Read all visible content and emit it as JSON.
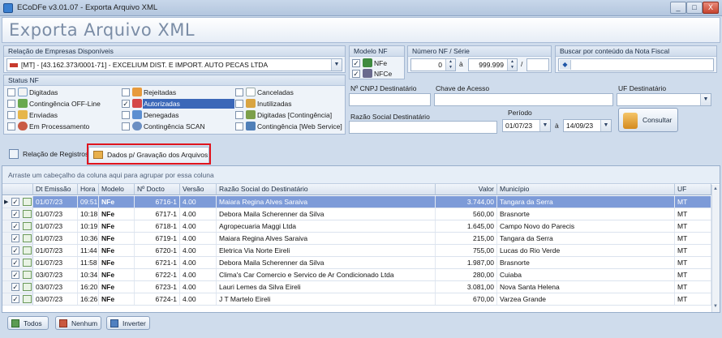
{
  "window": {
    "title": "ECoDFe v3.01.07 - Exporta Arquivo XML",
    "minimize": "_",
    "maximize": "□",
    "close": "X"
  },
  "header": {
    "title": "Exporta Arquivo XML"
  },
  "empresas": {
    "label": "Relação de Empresas Disponíveis",
    "selected": "[MT] - [43.162.373/0001-71] - EXCELIUM DIST. E IMPORT. AUTO PECAS LTDA"
  },
  "modelo": {
    "label": "Modelo NF",
    "nfe": "NFe",
    "nfce": "NFCe"
  },
  "numero": {
    "label": "Número NF / Série",
    "from": "0",
    "sep": "à",
    "to": "999.999",
    "slash": "/"
  },
  "buscar": {
    "label": "Buscar por conteúdo da Nota Fiscal"
  },
  "status": {
    "label": "Status NF",
    "items": [
      {
        "label": "Digitadas",
        "checked": false
      },
      {
        "label": "Contingência OFF-Line",
        "checked": false
      },
      {
        "label": "Enviadas",
        "checked": false
      },
      {
        "label": "Em Processamento",
        "checked": false
      },
      {
        "label": "Rejeitadas",
        "checked": false
      },
      {
        "label": "Autorizadas",
        "checked": true
      },
      {
        "label": "Denegadas",
        "checked": false
      },
      {
        "label": "Contingência SCAN",
        "checked": false
      },
      {
        "label": "Canceladas",
        "checked": false
      },
      {
        "label": "Inutilizadas",
        "checked": false
      },
      {
        "label": "Digitadas [Contingência]",
        "checked": false
      },
      {
        "label": "Contingência [Web Service]",
        "checked": false
      }
    ]
  },
  "filters": {
    "cnpj_label": "Nº CNPJ Destinatário",
    "chave_label": "Chave de Acesso",
    "uf_label": "UF Destinatário",
    "razao_label": "Razão Social Destinatário",
    "periodo_label": "Período",
    "periodo_from": "01/07/23",
    "periodo_sep": "à",
    "periodo_to": "14/09/23",
    "consultar": "Consultar"
  },
  "tabs": [
    {
      "label": "Relação de Registros"
    },
    {
      "label": "Dados p/ Gravação dos Arquivos"
    }
  ],
  "grid": {
    "group_hint": "Arraste um cabeçalho da coluna aqui para agrupar por essa coluna",
    "columns": [
      "Dt Emissão",
      "Hora",
      "Modelo",
      "Nº Docto",
      "Versão",
      "Razão Social do Destinatário",
      "Valor",
      "Município",
      "UF"
    ],
    "rows": [
      [
        "01/07/23",
        "09:51",
        "NFe",
        "6716-1",
        "4.00",
        "Maiara Regina Alves Saraiva",
        "3.744,00",
        "Tangara da Serra",
        "MT"
      ],
      [
        "01/07/23",
        "10:18",
        "NFe",
        "6717-1",
        "4.00",
        "Debora Maila Scherenner da Silva",
        "560,00",
        "Brasnorte",
        "MT"
      ],
      [
        "01/07/23",
        "10:19",
        "NFe",
        "6718-1",
        "4.00",
        "Agropecuaria Maggi Ltda",
        "1.645,00",
        "Campo Novo do Parecis",
        "MT"
      ],
      [
        "01/07/23",
        "10:36",
        "NFe",
        "6719-1",
        "4.00",
        "Maiara Regina Alves Saraiva",
        "215,00",
        "Tangara da Serra",
        "MT"
      ],
      [
        "01/07/23",
        "11:44",
        "NFe",
        "6720-1",
        "4.00",
        "Eletrica Via Norte Eireli",
        "755,00",
        "Lucas do Rio Verde",
        "MT"
      ],
      [
        "01/07/23",
        "11:58",
        "NFe",
        "6721-1",
        "4.00",
        "Debora Maila Scherenner da Silva",
        "1.987,00",
        "Brasnorte",
        "MT"
      ],
      [
        "03/07/23",
        "10:34",
        "NFe",
        "6722-1",
        "4.00",
        "Clima's Car Comercio e Servico de Ar Condicionado Ltda",
        "280,00",
        "Cuiaba",
        "MT"
      ],
      [
        "03/07/23",
        "16:20",
        "NFe",
        "6723-1",
        "4.00",
        "Lauri Lemes da Silva Eireli",
        "3.081,00",
        "Nova Santa Helena",
        "MT"
      ],
      [
        "03/07/23",
        "16:26",
        "NFe",
        "6724-1",
        "4.00",
        "J T Martelo Eireli",
        "670,00",
        "Varzea Grande",
        "MT"
      ]
    ]
  },
  "footer": {
    "todos": "Todos",
    "nenhum": "Nenhum",
    "inverter": "Inverter"
  },
  "colors": {
    "highlight_box": "#e0141e",
    "selected_row": "#7d9bd8",
    "selected_item": "#3b67b8"
  }
}
